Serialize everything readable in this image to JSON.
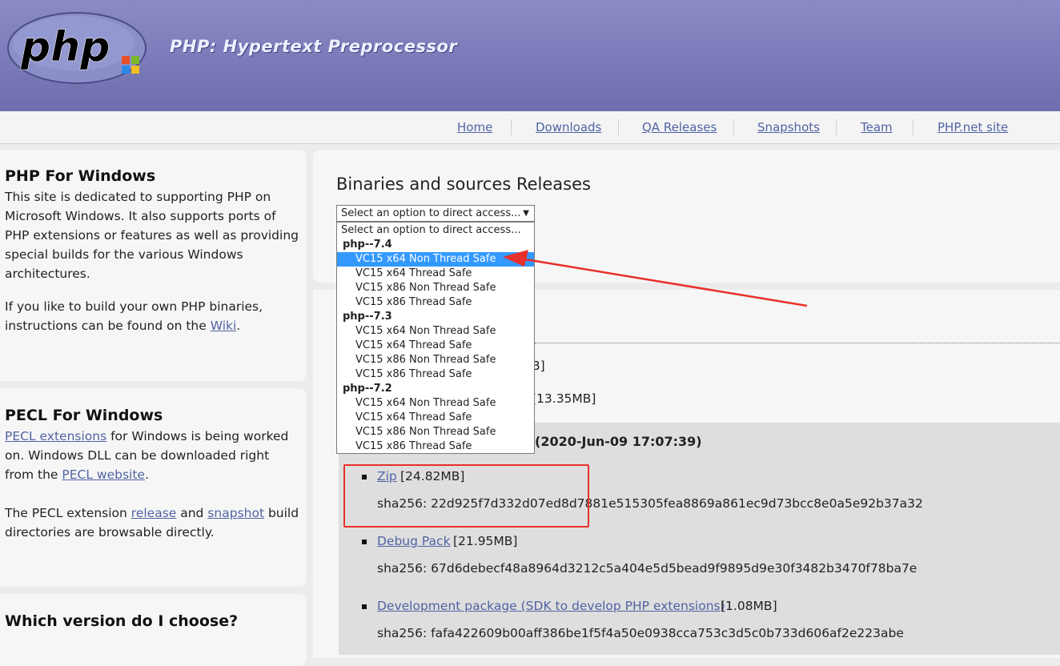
{
  "header": {
    "logo_text": "php",
    "site_title": "PHP: Hypertext Preprocessor"
  },
  "nav": {
    "items": [
      {
        "label": "Home"
      },
      {
        "label": "Downloads"
      },
      {
        "label": "QA Releases"
      },
      {
        "label": "Snapshots"
      },
      {
        "label": "Team"
      },
      {
        "label": "PHP.net site"
      }
    ]
  },
  "sidebar": {
    "php_windows": {
      "title": "PHP For Windows",
      "p1": "This site is dedicated to supporting PHP on Microsoft Windows. It also supports ports of PHP extensions or features as well as providing special builds for the various Windows architectures.",
      "p2_before": "If you like to build your own PHP binaries, instructions can be found on the ",
      "p2_link": "Wiki",
      "p2_after": "."
    },
    "pecl": {
      "title": "PECL For Windows",
      "p1_link1": "PECL extensions",
      "p1_mid": " for Windows is being worked on. Windows DLL can be downloaded right from the ",
      "p1_link2": "PECL website",
      "p1_end": ".",
      "p2_start": "The PECL extension ",
      "p2_link1": "release",
      "p2_mid": " and ",
      "p2_link2": "snapshot",
      "p2_end": " build directories are browsable directly."
    },
    "which": {
      "title": "Which version do I choose?"
    }
  },
  "main": {
    "title": "Binaries and sources Releases",
    "select_value": "Select an option to direct access...",
    "dropdown": {
      "placeholder": "Select an option to direct access...",
      "groups": [
        {
          "label": "php--7.4",
          "options": [
            "VC15 x64 Non Thread Safe",
            "VC15 x64 Thread Safe",
            "VC15 x86 Non Thread Safe",
            "VC15 x86 Thread Safe"
          ]
        },
        {
          "label": "php--7.3",
          "options": [
            "VC15 x64 Non Thread Safe",
            "VC15 x64 Thread Safe",
            "VC15 x86 Non Thread Safe",
            "VC15 x86 Thread Safe"
          ]
        },
        {
          "label": "php--7.2",
          "options": [
            "VC15 x64 Non Thread Safe",
            "VC15 x64 Thread Safe",
            "VC15 x86 Non Thread Safe",
            "VC15 x86 Thread Safe"
          ]
        }
      ],
      "selected": "VC15 x64 Non Thread Safe"
    },
    "partial_size_1": "B]",
    "partial_size_2": "[13.35MB]",
    "build_date": "(2020-Jun-09 17:07:39)",
    "downloads": [
      {
        "link": "Zip",
        "size": "[24.82MB]",
        "sha": "sha256: 22d925f7d332d07ed8d7881e515305fea8869a861ec9d73bcc8e0a5e92b37a32"
      },
      {
        "link": "Debug Pack",
        "size": "[21.95MB]",
        "sha": "sha256: 67d6debecf48a8964d3212c5a404e5d5bead9f9895d9e30f3482b3470f78ba7e"
      },
      {
        "link": "Development package (SDK to develop PHP extensions)",
        "size": "[1.08MB]",
        "sha": "sha256: fafa422609b00aff386be1f5f4a50e0938cca753c3d5c0b733d606af2e223abe"
      }
    ]
  },
  "annotation_color": "#e8302a",
  "link_color": "#5063a3"
}
